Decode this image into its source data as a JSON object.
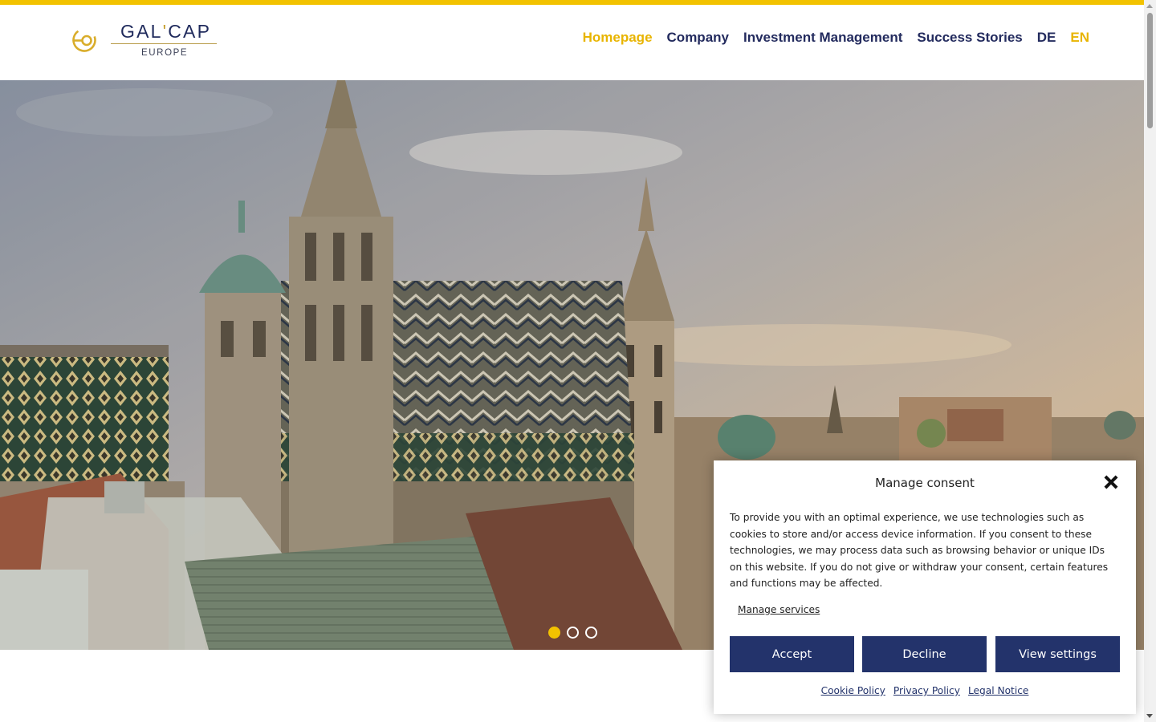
{
  "brand": {
    "name_left": "GAL",
    "name_right": "CAP",
    "apostrophe": "'",
    "subtitle": "EUROPE",
    "colors": {
      "navy": "#23336b",
      "gold": "#f2c200"
    }
  },
  "nav": {
    "items": [
      {
        "label": "Homepage",
        "active": true
      },
      {
        "label": "Company"
      },
      {
        "label": "Investment Management"
      },
      {
        "label": "Success Stories"
      },
      {
        "label": "DE"
      },
      {
        "label": "EN",
        "active": true
      }
    ]
  },
  "hero": {
    "slider": {
      "slide_count": 3,
      "current_slide": 1
    }
  },
  "consent": {
    "title": "Manage consent",
    "body": "To provide you with an optimal experience, we use technologies such as cookies to store and/or access device information. If you consent to these technologies, we may process data such as browsing behavior or unique IDs on this website. If you do not give or withdraw your consent, certain features and functions may be affected.",
    "manage_services": "Manage services",
    "buttons": {
      "accept": "Accept",
      "decline": "Decline",
      "view_settings": "View settings"
    },
    "links": {
      "cookie_policy": "Cookie Policy",
      "privacy_policy": "Privacy Policy",
      "legal_notice": "Legal Notice"
    }
  }
}
